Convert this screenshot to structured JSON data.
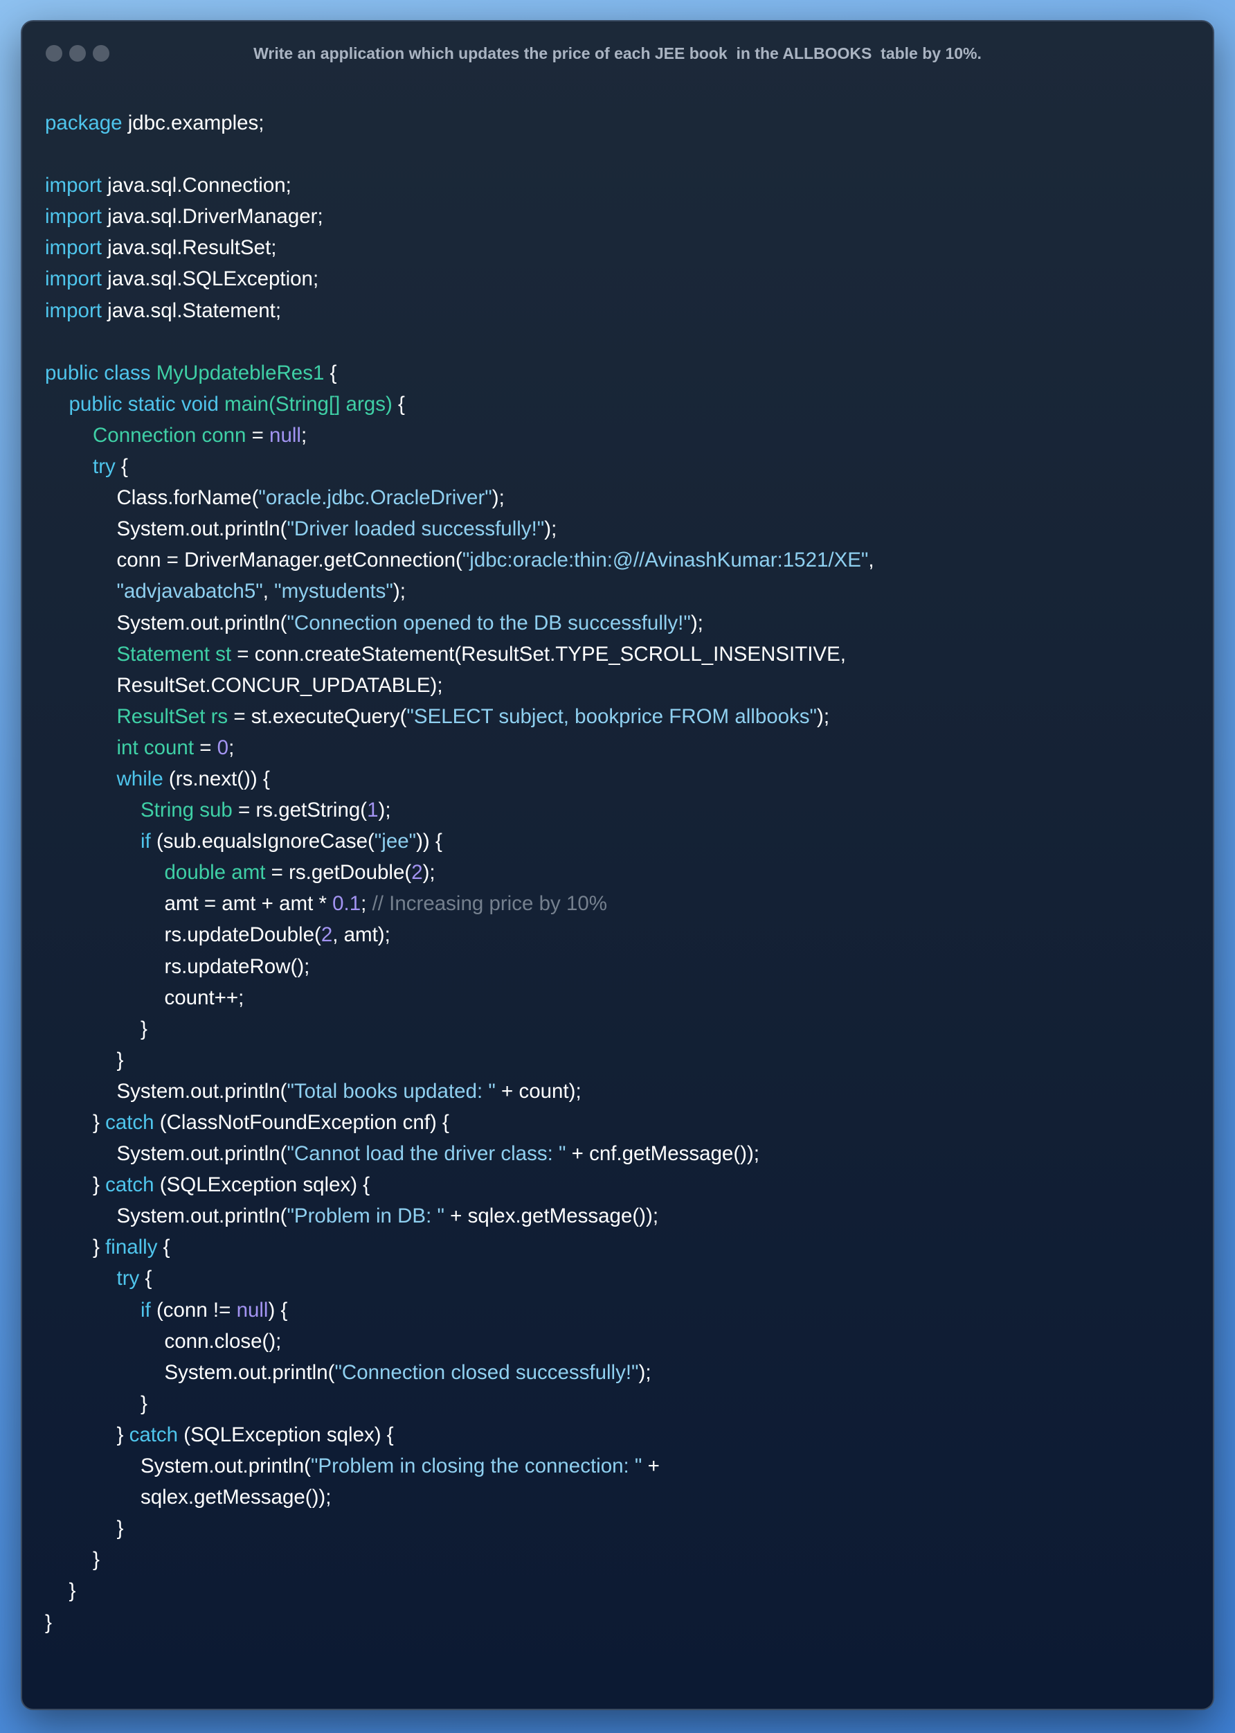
{
  "window": {
    "title": "Write an application which updates the price of each JEE book  in the ALLBOOKS  table by 10%."
  },
  "colors": {
    "keyword": "#4fc5ec",
    "type": "#3fd0a6",
    "string": "#8fd0f0",
    "number": "#a394f2",
    "comment": "#75808e",
    "text": "#ffffff"
  },
  "code": {
    "language": "java",
    "lines": [
      {
        "indent": 0,
        "tokens": [
          {
            "t": "package",
            "c": "kw"
          },
          {
            "t": " jdbc.examples;"
          }
        ]
      },
      {
        "indent": 0,
        "tokens": []
      },
      {
        "indent": 0,
        "tokens": [
          {
            "t": "import",
            "c": "kw"
          },
          {
            "t": " java.sql.Connection;"
          }
        ]
      },
      {
        "indent": 0,
        "tokens": [
          {
            "t": "import",
            "c": "kw"
          },
          {
            "t": " java.sql.DriverManager;"
          }
        ]
      },
      {
        "indent": 0,
        "tokens": [
          {
            "t": "import",
            "c": "kw"
          },
          {
            "t": " java.sql.ResultSet;"
          }
        ]
      },
      {
        "indent": 0,
        "tokens": [
          {
            "t": "import",
            "c": "kw"
          },
          {
            "t": " java.sql.SQLException;"
          }
        ]
      },
      {
        "indent": 0,
        "tokens": [
          {
            "t": "import",
            "c": "kw"
          },
          {
            "t": " java.sql.Statement;"
          }
        ]
      },
      {
        "indent": 0,
        "tokens": []
      },
      {
        "indent": 0,
        "tokens": [
          {
            "t": "public class ",
            "c": "kw"
          },
          {
            "t": "MyUpdatebleRes1",
            "c": "ty"
          },
          {
            "t": " {"
          }
        ]
      },
      {
        "indent": 1,
        "tokens": [
          {
            "t": "public static void ",
            "c": "kw"
          },
          {
            "t": "main(String[] args)",
            "c": "ty"
          },
          {
            "t": " {"
          }
        ]
      },
      {
        "indent": 2,
        "tokens": [
          {
            "t": "Connection conn",
            "c": "ty"
          },
          {
            "t": " = "
          },
          {
            "t": "null",
            "c": "num"
          },
          {
            "t": ";"
          }
        ]
      },
      {
        "indent": 2,
        "tokens": [
          {
            "t": "try",
            "c": "kw"
          },
          {
            "t": " {"
          }
        ]
      },
      {
        "indent": 3,
        "tokens": [
          {
            "t": "Class.forName("
          },
          {
            "t": "\"oracle.jdbc.OracleDriver\"",
            "c": "str"
          },
          {
            "t": ");"
          }
        ]
      },
      {
        "indent": 3,
        "tokens": [
          {
            "t": "System.out.println("
          },
          {
            "t": "\"Driver loaded successfully!\"",
            "c": "str"
          },
          {
            "t": ");"
          }
        ]
      },
      {
        "indent": 3,
        "tokens": [
          {
            "t": "conn = DriverManager.getConnection("
          },
          {
            "t": "\"jdbc:oracle:thin:@//AvinashKumar:1521/XE\"",
            "c": "str"
          },
          {
            "t": ","
          }
        ]
      },
      {
        "indent": 3,
        "tokens": [
          {
            "t": "\"advjavabatch5\"",
            "c": "str"
          },
          {
            "t": ", "
          },
          {
            "t": "\"mystudents\"",
            "c": "str"
          },
          {
            "t": ");"
          }
        ]
      },
      {
        "indent": 3,
        "tokens": [
          {
            "t": "System.out.println("
          },
          {
            "t": "\"Connection opened to the DB successfully!\"",
            "c": "str"
          },
          {
            "t": ");"
          }
        ]
      },
      {
        "indent": 3,
        "tokens": [
          {
            "t": "Statement st",
            "c": "ty"
          },
          {
            "t": " = conn.createStatement(ResultSet.TYPE_SCROLL_INSENSITIVE,"
          }
        ]
      },
      {
        "indent": 3,
        "tokens": [
          {
            "t": "ResultSet.CONCUR_UPDATABLE);"
          }
        ]
      },
      {
        "indent": 3,
        "tokens": [
          {
            "t": "ResultSet rs",
            "c": "ty"
          },
          {
            "t": " = st.executeQuery("
          },
          {
            "t": "\"SELECT subject, bookprice FROM allbooks\"",
            "c": "str"
          },
          {
            "t": ");"
          }
        ]
      },
      {
        "indent": 3,
        "tokens": [
          {
            "t": "int count",
            "c": "ty"
          },
          {
            "t": " = "
          },
          {
            "t": "0",
            "c": "num"
          },
          {
            "t": ";"
          }
        ]
      },
      {
        "indent": 3,
        "tokens": [
          {
            "t": "while",
            "c": "kw"
          },
          {
            "t": " (rs.next()) {"
          }
        ]
      },
      {
        "indent": 4,
        "tokens": [
          {
            "t": "String sub",
            "c": "ty"
          },
          {
            "t": " = rs.getString("
          },
          {
            "t": "1",
            "c": "num"
          },
          {
            "t": ");"
          }
        ]
      },
      {
        "indent": 4,
        "tokens": [
          {
            "t": "if",
            "c": "kw"
          },
          {
            "t": " (sub.equalsIgnoreCase("
          },
          {
            "t": "\"jee\"",
            "c": "str"
          },
          {
            "t": ")) {"
          }
        ]
      },
      {
        "indent": 5,
        "tokens": [
          {
            "t": "double amt",
            "c": "ty"
          },
          {
            "t": " = rs.getDouble("
          },
          {
            "t": "2",
            "c": "num"
          },
          {
            "t": ");"
          }
        ]
      },
      {
        "indent": 5,
        "tokens": [
          {
            "t": "amt = amt + amt * "
          },
          {
            "t": "0.1",
            "c": "num"
          },
          {
            "t": "; "
          },
          {
            "t": "// Increasing price by 10%",
            "c": "cm"
          }
        ]
      },
      {
        "indent": 5,
        "tokens": [
          {
            "t": "rs.updateDouble("
          },
          {
            "t": "2",
            "c": "num"
          },
          {
            "t": ", amt);"
          }
        ]
      },
      {
        "indent": 5,
        "tokens": [
          {
            "t": "rs.updateRow();"
          }
        ]
      },
      {
        "indent": 5,
        "tokens": [
          {
            "t": "count++;"
          }
        ]
      },
      {
        "indent": 4,
        "tokens": [
          {
            "t": "}"
          }
        ]
      },
      {
        "indent": 3,
        "tokens": [
          {
            "t": "}"
          }
        ]
      },
      {
        "indent": 3,
        "tokens": [
          {
            "t": "System.out.println("
          },
          {
            "t": "\"Total books updated: \"",
            "c": "str"
          },
          {
            "t": " + count);"
          }
        ]
      },
      {
        "indent": 2,
        "tokens": [
          {
            "t": "} "
          },
          {
            "t": "catch",
            "c": "kw"
          },
          {
            "t": " (ClassNotFoundException cnf) {"
          }
        ]
      },
      {
        "indent": 3,
        "tokens": [
          {
            "t": "System.out.println("
          },
          {
            "t": "\"Cannot load the driver class: \"",
            "c": "str"
          },
          {
            "t": " + cnf.getMessage());"
          }
        ]
      },
      {
        "indent": 2,
        "tokens": [
          {
            "t": "} "
          },
          {
            "t": "catch",
            "c": "kw"
          },
          {
            "t": " (SQLException sqlex) {"
          }
        ]
      },
      {
        "indent": 3,
        "tokens": [
          {
            "t": "System.out.println("
          },
          {
            "t": "\"Problem in DB: \"",
            "c": "str"
          },
          {
            "t": " + sqlex.getMessage());"
          }
        ]
      },
      {
        "indent": 2,
        "tokens": [
          {
            "t": "} "
          },
          {
            "t": "finally",
            "c": "kw"
          },
          {
            "t": " {"
          }
        ]
      },
      {
        "indent": 3,
        "tokens": [
          {
            "t": "try",
            "c": "kw"
          },
          {
            "t": " {"
          }
        ]
      },
      {
        "indent": 4,
        "tokens": [
          {
            "t": "if",
            "c": "kw"
          },
          {
            "t": " (conn != "
          },
          {
            "t": "null",
            "c": "num"
          },
          {
            "t": ") {"
          }
        ]
      },
      {
        "indent": 5,
        "tokens": [
          {
            "t": "conn.close();"
          }
        ]
      },
      {
        "indent": 5,
        "tokens": [
          {
            "t": "System.out.println("
          },
          {
            "t": "\"Connection closed successfully!\"",
            "c": "str"
          },
          {
            "t": ");"
          }
        ]
      },
      {
        "indent": 4,
        "tokens": [
          {
            "t": "}"
          }
        ]
      },
      {
        "indent": 3,
        "tokens": [
          {
            "t": "} "
          },
          {
            "t": "catch",
            "c": "kw"
          },
          {
            "t": " (SQLException sqlex) {"
          }
        ]
      },
      {
        "indent": 4,
        "tokens": [
          {
            "t": "System.out.println("
          },
          {
            "t": "\"Problem in closing the connection: \"",
            "c": "str"
          },
          {
            "t": " +"
          }
        ]
      },
      {
        "indent": 4,
        "tokens": [
          {
            "t": "sqlex.getMessage());"
          }
        ]
      },
      {
        "indent": 3,
        "tokens": [
          {
            "t": "}"
          }
        ]
      },
      {
        "indent": 2,
        "tokens": [
          {
            "t": "}"
          }
        ]
      },
      {
        "indent": 1,
        "tokens": [
          {
            "t": "}"
          }
        ]
      },
      {
        "indent": 0,
        "tokens": [
          {
            "t": "}"
          }
        ]
      }
    ]
  }
}
